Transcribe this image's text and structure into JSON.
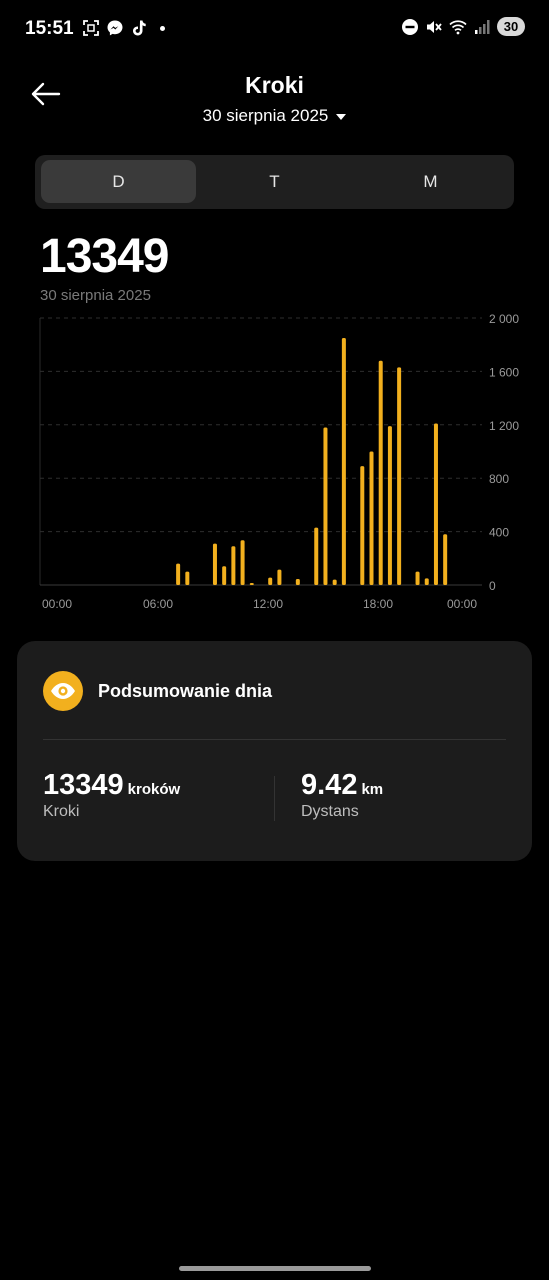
{
  "status_bar": {
    "time": "15:51",
    "left_icons": [
      "screenshot-icon",
      "messenger-icon",
      "tiktok-icon",
      "dot-icon"
    ],
    "right_icons": [
      "dnd-icon",
      "mute-icon",
      "wifi-icon",
      "signal-icon"
    ],
    "battery": "30"
  },
  "header": {
    "title": "Kroki",
    "date": "30 sierpnia 2025"
  },
  "tabs": [
    {
      "label": "D",
      "active": true
    },
    {
      "label": "T",
      "active": false
    },
    {
      "label": "M",
      "active": false
    }
  ],
  "total": {
    "steps": "13349",
    "date": "30 sierpnia 2025"
  },
  "chart_data": {
    "type": "bar",
    "x_ticks": [
      "00:00",
      "06:00",
      "12:00",
      "18:00",
      "00:00"
    ],
    "y_ticks": [
      "2 000",
      "1 600",
      "1 200",
      "800",
      "400",
      "0"
    ],
    "ylim": [
      0,
      2000
    ],
    "grid": true,
    "bar_color": "#f2b01e",
    "x": [
      "07:30",
      "08:00",
      "09:30",
      "10:00",
      "10:30",
      "11:00",
      "11:30",
      "12:30",
      "13:00",
      "14:00",
      "15:00",
      "15:30",
      "16:00",
      "16:30",
      "17:30",
      "18:00",
      "18:30",
      "19:00",
      "19:30",
      "20:30",
      "21:00",
      "21:30",
      "22:00",
      "22:30"
    ],
    "values": [
      160,
      100,
      310,
      140,
      290,
      335,
      15,
      55,
      115,
      45,
      430,
      1180,
      40,
      1850,
      890,
      1000,
      1680,
      1190,
      1630,
      100,
      50,
      1210,
      380,
      0
    ]
  },
  "summary": {
    "title": "Podsumowanie dnia",
    "icon": "eye-icon",
    "accent": "#f2b01e",
    "steps_value": "13349",
    "steps_unit": "kroków",
    "steps_label": "Kroki",
    "distance_value": "9.42",
    "distance_unit": "km",
    "distance_label": "Dystans"
  }
}
